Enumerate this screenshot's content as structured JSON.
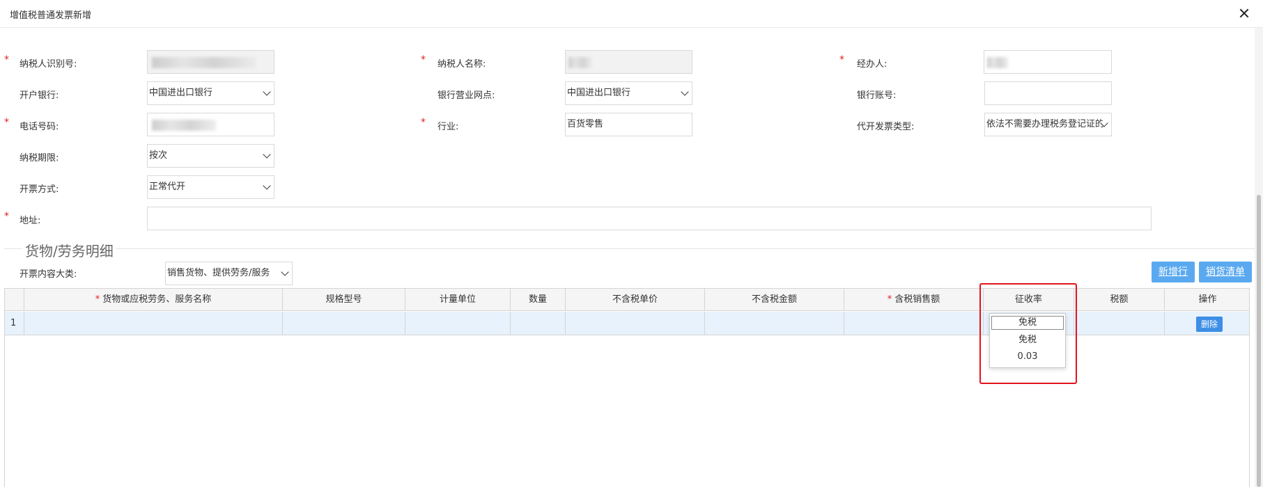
{
  "window": {
    "title": "增值税普通发票新增"
  },
  "form": {
    "taxpayer_id_label": "纳税人识别号:",
    "taxpayer_name_label": "纳税人名称:",
    "handler_label": "经办人:",
    "bank_label": "开户银行:",
    "bank_value": "中国进出口银行",
    "bank_branch_label": "银行营业网点:",
    "bank_branch_value": "中国进出口银行",
    "bank_account_label": "银行账号:",
    "bank_account_value": "",
    "phone_label": "电话号码:",
    "industry_label": "行业:",
    "industry_value": "百货零售",
    "invoice_type_label": "代开发票类型:",
    "invoice_type_value": "依法不需要办理税务登记证的",
    "tax_period_label": "纳税期限:",
    "tax_period_value": "按次",
    "issue_method_label": "开票方式:",
    "issue_method_value": "正常代开",
    "address_label": "地址:",
    "address_value": "",
    "required_mark": "*"
  },
  "goods": {
    "section_title": "货物/劳务明细",
    "category_label": "开票内容大类:",
    "category_value": "销售货物、提供劳务/服务",
    "add_row_button": "新增行",
    "sales_list_button": "销货清单",
    "columns": [
      "货物或应税劳务、服务名称",
      "规格型号",
      "计量单位",
      "数量",
      "不含税单价",
      "不含税金额",
      "含税销售额",
      "征收率",
      "税额",
      "操作"
    ],
    "rows": [
      {
        "index": "1",
        "action": "删除"
      }
    ],
    "rate_dropdown": {
      "selected": "免税",
      "options": [
        "免税",
        "0.03"
      ]
    }
  },
  "colors": {
    "required": "#e02020",
    "button": "#5aa9f0",
    "row_highlight": "#e8f2fc",
    "callout_border": "#e0141c"
  }
}
